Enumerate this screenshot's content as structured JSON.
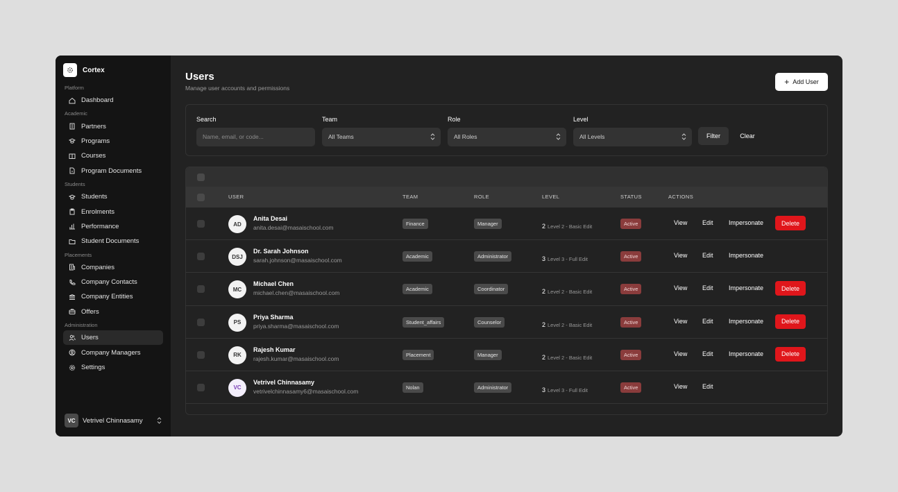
{
  "brand": {
    "name": "Cortex"
  },
  "sidebar": {
    "sections": [
      {
        "label": "Platform",
        "items": [
          {
            "label": "Dashboard",
            "icon": "home-icon"
          }
        ]
      },
      {
        "label": "Academic",
        "items": [
          {
            "label": "Partners",
            "icon": "building-icon"
          },
          {
            "label": "Programs",
            "icon": "graduation-cap-icon"
          },
          {
            "label": "Courses",
            "icon": "book-open-icon"
          },
          {
            "label": "Program Documents",
            "icon": "document-icon"
          }
        ]
      },
      {
        "label": "Students",
        "items": [
          {
            "label": "Students",
            "icon": "graduation-cap-icon"
          },
          {
            "label": "Enrolments",
            "icon": "clipboard-icon"
          },
          {
            "label": "Performance",
            "icon": "bar-chart-icon"
          },
          {
            "label": "Student Documents",
            "icon": "folder-icon"
          }
        ]
      },
      {
        "label": "Placements",
        "items": [
          {
            "label": "Companies",
            "icon": "office-building-icon"
          },
          {
            "label": "Company Contacts",
            "icon": "phone-icon"
          },
          {
            "label": "Company Entities",
            "icon": "bank-icon"
          },
          {
            "label": "Offers",
            "icon": "briefcase-icon"
          }
        ]
      },
      {
        "label": "Administration",
        "items": [
          {
            "label": "Users",
            "icon": "users-icon",
            "active": true
          },
          {
            "label": "Company Managers",
            "icon": "user-circle-icon"
          },
          {
            "label": "Settings",
            "icon": "gear-icon"
          }
        ]
      }
    ],
    "user": {
      "initials": "VC",
      "name": "Vetrivel Chinnasamy"
    }
  },
  "header": {
    "title": "Users",
    "subtitle": "Manage user accounts and permissions",
    "add_button": "Add User"
  },
  "filters": {
    "search_label": "Search",
    "search_placeholder": "Name, email, or code...",
    "team_label": "Team",
    "team_value": "All Teams",
    "role_label": "Role",
    "role_value": "All Roles",
    "level_label": "Level",
    "level_value": "All Levels",
    "filter_button": "Filter",
    "clear_button": "Clear"
  },
  "table": {
    "columns": {
      "user": "USER",
      "team": "TEAM",
      "role": "ROLE",
      "level": "LEVEL",
      "status": "STATUS",
      "actions": "ACTIONS"
    },
    "action_labels": {
      "view": "View",
      "edit": "Edit",
      "impersonate": "Impersonate",
      "delete": "Delete"
    },
    "rows": [
      {
        "initials": "AD",
        "name": "Anita Desai",
        "email": "anita.desai@masaischool.com",
        "team": "Finance",
        "role": "Manager",
        "level": "2",
        "level_text": "Level 2 - Basic Edit",
        "status": "Active",
        "impersonate": true,
        "delete": true
      },
      {
        "initials": "DSJ",
        "name": "Dr. Sarah Johnson",
        "email": "sarah.johnson@masaischool.com",
        "team": "Academic",
        "role": "Administrator",
        "level": "3",
        "level_text": "Level 3 - Full Edit",
        "status": "Active",
        "impersonate": true,
        "delete": false
      },
      {
        "initials": "MC",
        "name": "Michael Chen",
        "email": "michael.chen@masaischool.com",
        "team": "Academic",
        "role": "Coordinator",
        "level": "2",
        "level_text": "Level 2 - Basic Edit",
        "status": "Active",
        "impersonate": true,
        "delete": true
      },
      {
        "initials": "PS",
        "name": "Priya Sharma",
        "email": "priya.sharma@masaischool.com",
        "team": "Student_affairs",
        "role": "Counselor",
        "level": "2",
        "level_text": "Level 2 - Basic Edit",
        "status": "Active",
        "impersonate": true,
        "delete": true
      },
      {
        "initials": "RK",
        "name": "Rajesh Kumar",
        "email": "rajesh.kumar@masaischool.com",
        "team": "Placement",
        "role": "Manager",
        "level": "2",
        "level_text": "Level 2 - Basic Edit",
        "status": "Active",
        "impersonate": true,
        "delete": true
      },
      {
        "initials": "VC",
        "name": "Vetrivel Chinnasamy",
        "email": "vetrivelchinnasamy6@masaischool.com",
        "team": "Nolan",
        "role": "Administrator",
        "level": "3",
        "level_text": "Level 3 - Full Edit",
        "status": "Active",
        "impersonate": false,
        "delete": false,
        "avatar_color": "#7b3fb8"
      }
    ]
  }
}
